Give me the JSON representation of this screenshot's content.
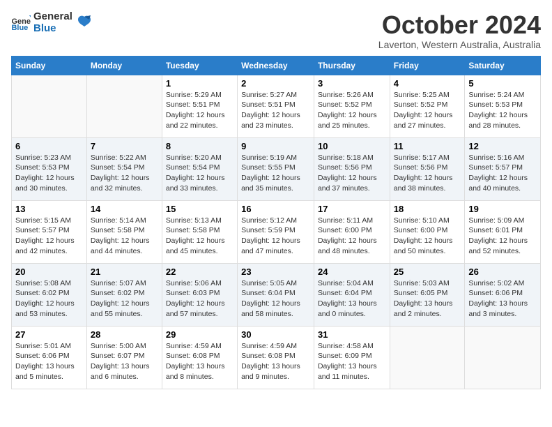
{
  "header": {
    "logo_general": "General",
    "logo_blue": "Blue",
    "month_title": "October 2024",
    "subtitle": "Laverton, Western Australia, Australia"
  },
  "days_of_week": [
    "Sunday",
    "Monday",
    "Tuesday",
    "Wednesday",
    "Thursday",
    "Friday",
    "Saturday"
  ],
  "weeks": [
    [
      {
        "day": "",
        "info": ""
      },
      {
        "day": "",
        "info": ""
      },
      {
        "day": "1",
        "info": "Sunrise: 5:29 AM\nSunset: 5:51 PM\nDaylight: 12 hours and 22 minutes."
      },
      {
        "day": "2",
        "info": "Sunrise: 5:27 AM\nSunset: 5:51 PM\nDaylight: 12 hours and 23 minutes."
      },
      {
        "day": "3",
        "info": "Sunrise: 5:26 AM\nSunset: 5:52 PM\nDaylight: 12 hours and 25 minutes."
      },
      {
        "day": "4",
        "info": "Sunrise: 5:25 AM\nSunset: 5:52 PM\nDaylight: 12 hours and 27 minutes."
      },
      {
        "day": "5",
        "info": "Sunrise: 5:24 AM\nSunset: 5:53 PM\nDaylight: 12 hours and 28 minutes."
      }
    ],
    [
      {
        "day": "6",
        "info": "Sunrise: 5:23 AM\nSunset: 5:53 PM\nDaylight: 12 hours and 30 minutes."
      },
      {
        "day": "7",
        "info": "Sunrise: 5:22 AM\nSunset: 5:54 PM\nDaylight: 12 hours and 32 minutes."
      },
      {
        "day": "8",
        "info": "Sunrise: 5:20 AM\nSunset: 5:54 PM\nDaylight: 12 hours and 33 minutes."
      },
      {
        "day": "9",
        "info": "Sunrise: 5:19 AM\nSunset: 5:55 PM\nDaylight: 12 hours and 35 minutes."
      },
      {
        "day": "10",
        "info": "Sunrise: 5:18 AM\nSunset: 5:56 PM\nDaylight: 12 hours and 37 minutes."
      },
      {
        "day": "11",
        "info": "Sunrise: 5:17 AM\nSunset: 5:56 PM\nDaylight: 12 hours and 38 minutes."
      },
      {
        "day": "12",
        "info": "Sunrise: 5:16 AM\nSunset: 5:57 PM\nDaylight: 12 hours and 40 minutes."
      }
    ],
    [
      {
        "day": "13",
        "info": "Sunrise: 5:15 AM\nSunset: 5:57 PM\nDaylight: 12 hours and 42 minutes."
      },
      {
        "day": "14",
        "info": "Sunrise: 5:14 AM\nSunset: 5:58 PM\nDaylight: 12 hours and 44 minutes."
      },
      {
        "day": "15",
        "info": "Sunrise: 5:13 AM\nSunset: 5:58 PM\nDaylight: 12 hours and 45 minutes."
      },
      {
        "day": "16",
        "info": "Sunrise: 5:12 AM\nSunset: 5:59 PM\nDaylight: 12 hours and 47 minutes."
      },
      {
        "day": "17",
        "info": "Sunrise: 5:11 AM\nSunset: 6:00 PM\nDaylight: 12 hours and 48 minutes."
      },
      {
        "day": "18",
        "info": "Sunrise: 5:10 AM\nSunset: 6:00 PM\nDaylight: 12 hours and 50 minutes."
      },
      {
        "day": "19",
        "info": "Sunrise: 5:09 AM\nSunset: 6:01 PM\nDaylight: 12 hours and 52 minutes."
      }
    ],
    [
      {
        "day": "20",
        "info": "Sunrise: 5:08 AM\nSunset: 6:02 PM\nDaylight: 12 hours and 53 minutes."
      },
      {
        "day": "21",
        "info": "Sunrise: 5:07 AM\nSunset: 6:02 PM\nDaylight: 12 hours and 55 minutes."
      },
      {
        "day": "22",
        "info": "Sunrise: 5:06 AM\nSunset: 6:03 PM\nDaylight: 12 hours and 57 minutes."
      },
      {
        "day": "23",
        "info": "Sunrise: 5:05 AM\nSunset: 6:04 PM\nDaylight: 12 hours and 58 minutes."
      },
      {
        "day": "24",
        "info": "Sunrise: 5:04 AM\nSunset: 6:04 PM\nDaylight: 13 hours and 0 minutes."
      },
      {
        "day": "25",
        "info": "Sunrise: 5:03 AM\nSunset: 6:05 PM\nDaylight: 13 hours and 2 minutes."
      },
      {
        "day": "26",
        "info": "Sunrise: 5:02 AM\nSunset: 6:06 PM\nDaylight: 13 hours and 3 minutes."
      }
    ],
    [
      {
        "day": "27",
        "info": "Sunrise: 5:01 AM\nSunset: 6:06 PM\nDaylight: 13 hours and 5 minutes."
      },
      {
        "day": "28",
        "info": "Sunrise: 5:00 AM\nSunset: 6:07 PM\nDaylight: 13 hours and 6 minutes."
      },
      {
        "day": "29",
        "info": "Sunrise: 4:59 AM\nSunset: 6:08 PM\nDaylight: 13 hours and 8 minutes."
      },
      {
        "day": "30",
        "info": "Sunrise: 4:59 AM\nSunset: 6:08 PM\nDaylight: 13 hours and 9 minutes."
      },
      {
        "day": "31",
        "info": "Sunrise: 4:58 AM\nSunset: 6:09 PM\nDaylight: 13 hours and 11 minutes."
      },
      {
        "day": "",
        "info": ""
      },
      {
        "day": "",
        "info": ""
      }
    ]
  ]
}
